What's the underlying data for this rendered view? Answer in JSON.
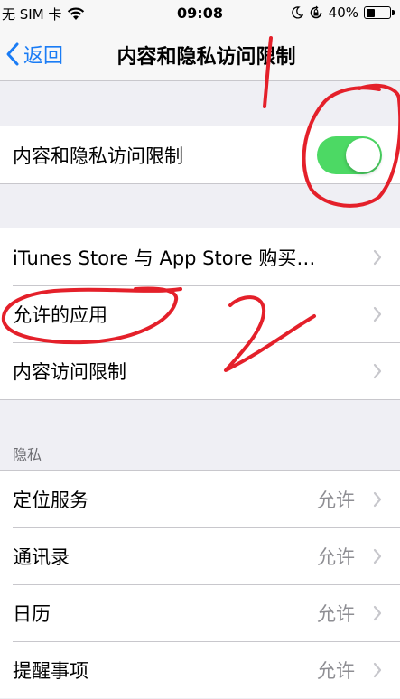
{
  "status_bar": {
    "carrier": "无 SIM 卡",
    "time": "09:08",
    "battery_percent": "40%",
    "battery_level": 0.4,
    "icons": [
      "wifi-icon",
      "moon-icon",
      "rotation-lock-icon",
      "battery-icon"
    ]
  },
  "nav": {
    "back_label": "返回",
    "title": "内容和隐私访问限制"
  },
  "restriction_group": {
    "label": "内容和隐私访问限制",
    "enabled": true,
    "toggle_color": "#4cd964"
  },
  "content_group": {
    "items": [
      {
        "label": "iTunes Store 与 App Store 购买…"
      },
      {
        "label": "允许的应用"
      },
      {
        "label": "内容访问限制"
      }
    ]
  },
  "privacy": {
    "header": "隐私",
    "items": [
      {
        "label": "定位服务",
        "value": "允许"
      },
      {
        "label": "通讯录",
        "value": "允许"
      },
      {
        "label": "日历",
        "value": "允许"
      },
      {
        "label": "提醒事项",
        "value": "允许"
      }
    ]
  },
  "colors": {
    "accent": "#1a7cf5",
    "annotation": "#e4202a"
  }
}
